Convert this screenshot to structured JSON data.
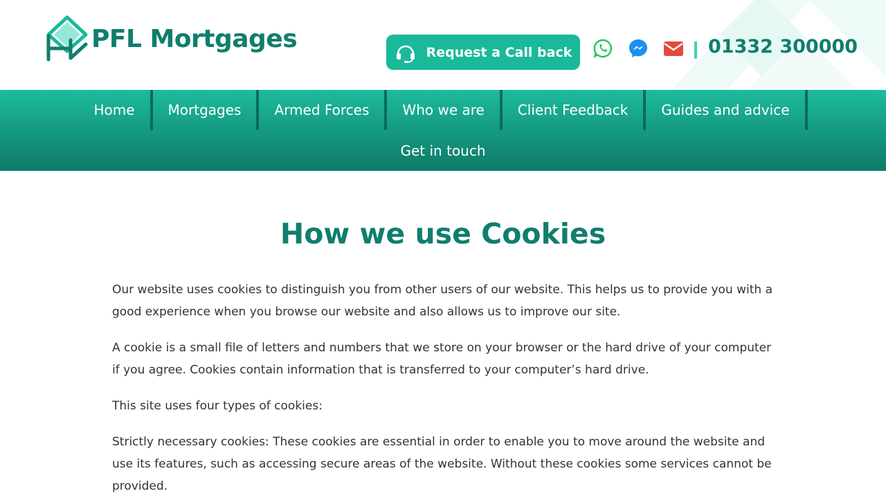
{
  "header": {
    "logo_text": "PFL Mortgages",
    "callback_label": "Request a Call back",
    "phone": "01332 300000",
    "icons": [
      "whatsapp-icon",
      "messenger-icon",
      "envelope-icon"
    ]
  },
  "nav": {
    "items": [
      {
        "label": "Home"
      },
      {
        "label": "Mortgages"
      },
      {
        "label": "Armed Forces"
      },
      {
        "label": "Who we are"
      },
      {
        "label": "Client Feedback"
      },
      {
        "label": "Guides and advice"
      },
      {
        "label": "Get in touch"
      }
    ]
  },
  "main": {
    "title": "How we use Cookies",
    "paragraphs": [
      "Our website uses cookies to distinguish you from other users of our website. This helps us to provide you with a good experience when you browse our website and also allows us to improve our site.",
      "A cookie is a small file of letters and numbers that we store on your browser or the hard drive of your computer if you agree. Cookies contain information that is transferred to your computer’s hard drive.",
      "This site uses four types of cookies:",
      "Strictly necessary cookies: These cookies are essential in order to enable you to move around the website and use its features, such as accessing secure areas of the website. Without these cookies some services cannot be provided."
    ]
  },
  "colors": {
    "brand_teal": "#0f7e6e",
    "button_teal": "#1ab99a",
    "whatsapp_green": "#25c55f",
    "messenger_blue": "#1e8ff2",
    "email_red": "#e04a3c"
  }
}
